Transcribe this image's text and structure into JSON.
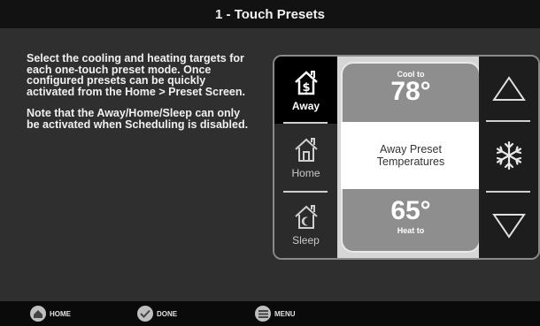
{
  "header": {
    "title": "1 - Touch Presets"
  },
  "description": {
    "paragraph1": "Select the cooling and heating targets for each one-touch preset mode. Once configured presets can be quickly activated from the Home > Preset Screen.",
    "paragraph2": "Note that the Away/Home/Sleep can only be activated when Scheduling is disabled."
  },
  "modes": [
    {
      "label": "Away",
      "icon": "house-dollar-icon",
      "active": true
    },
    {
      "label": "Home",
      "icon": "house-icon",
      "active": false
    },
    {
      "label": "Sleep",
      "icon": "house-moon-icon",
      "active": false
    }
  ],
  "preset": {
    "cool_label": "Cool to",
    "cool_value": "78°",
    "title_line1": "Away Preset",
    "title_line2": "Temperatures",
    "heat_value": "65°",
    "heat_label": "Heat to"
  },
  "controls": [
    "up-arrow-icon",
    "snowflake-icon",
    "down-arrow-icon"
  ],
  "footer": {
    "home_label": "HOME",
    "done_label": "DONE",
    "menu_label": "MENU"
  }
}
